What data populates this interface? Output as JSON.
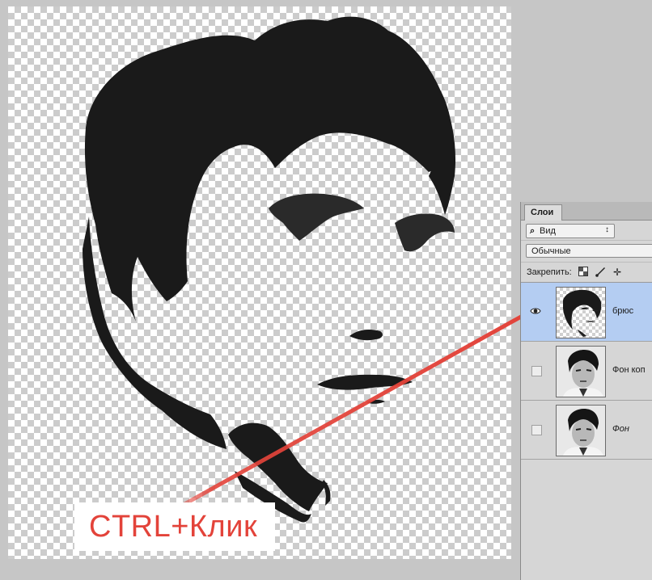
{
  "annotation": {
    "caption": "CTRL+Клик",
    "color": "#e3433a"
  },
  "layers_panel": {
    "tab_label": "Слои",
    "kind_filter": {
      "icon": "search-icon",
      "value": "Вид"
    },
    "blend_mode": "Обычные",
    "lock_label": "Закрепить:",
    "lock_icons": [
      "lock-transparent-pixels-icon",
      "lock-image-pixels-icon",
      "lock-position-icon"
    ],
    "layers": [
      {
        "name": "брюс",
        "visible": true,
        "selected": true,
        "italic": false
      },
      {
        "name": "Фон коп",
        "visible": false,
        "selected": false,
        "italic": false
      },
      {
        "name": "Фон",
        "visible": false,
        "selected": false,
        "italic": true
      }
    ]
  },
  "colors": {
    "workspace": "#c6c6c6",
    "selection": "#b4cdf2",
    "silhouette": "#1a1a1a"
  }
}
